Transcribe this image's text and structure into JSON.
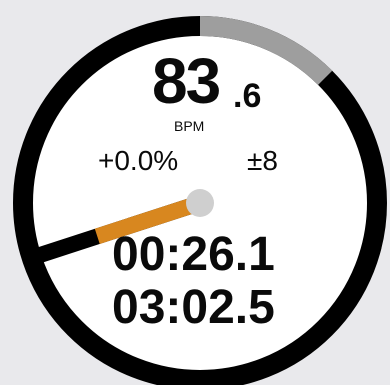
{
  "deck": {
    "bpm_integer": "83",
    "bpm_decimal": ".6",
    "bpm_unit": "BPM",
    "pitch": "+0.0%",
    "pitch_range": "±8",
    "time_elapsed": "00:26.1",
    "time_remaining": "03:02.5",
    "track_progress": 0.125,
    "platter_angle_deg": 252,
    "colors": {
      "background": "#e9e9ec",
      "face": "#ffffff",
      "ring": "#000000",
      "progress": "#9e9e9e",
      "needle": "#000000",
      "needle_accent": "#d8871f",
      "hub": "#cfcfcf",
      "text": "#0a0a0a"
    }
  }
}
